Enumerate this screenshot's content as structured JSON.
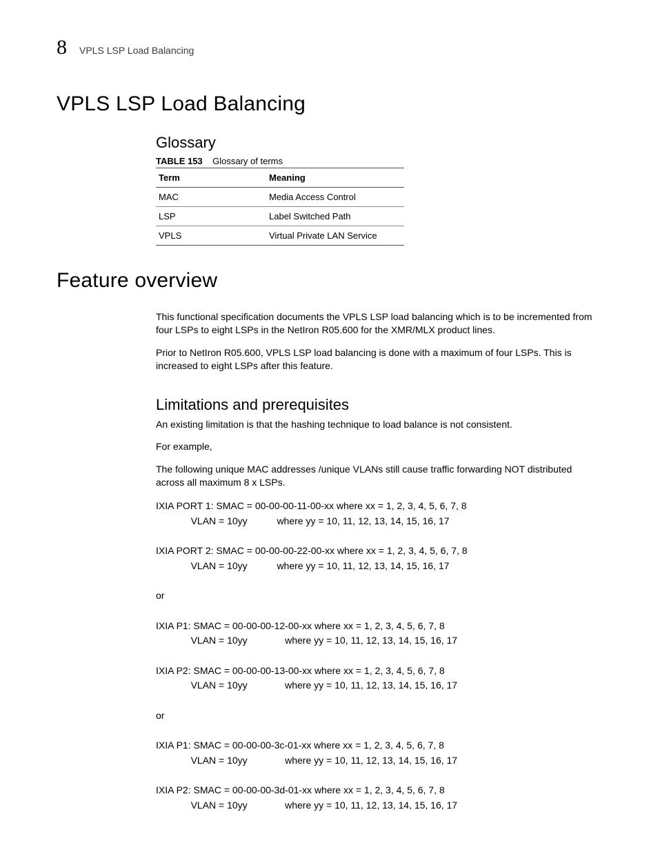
{
  "header": {
    "chapter_number": "8",
    "running_title": "VPLS LSP Load Balancing"
  },
  "section1": {
    "title": "VPLS LSP Load Balancing",
    "glossary": {
      "heading": "Glossary",
      "table_number": "TABLE 153",
      "table_caption": "Glossary of terms",
      "col_term": "Term",
      "col_meaning": "Meaning",
      "rows": [
        {
          "term": "MAC",
          "meaning": "Media Access Control"
        },
        {
          "term": "LSP",
          "meaning": "Label Switched Path"
        },
        {
          "term": "VPLS",
          "meaning": "Virtual Private LAN Service"
        }
      ]
    }
  },
  "section2": {
    "title": "Feature overview",
    "para1": "This functional specification documents the VPLS LSP load balancing which is to be incremented from four LSPs to eight LSPs in the NetIron R05.600 for the XMR/MLX product lines.",
    "para2": "Prior to NetIron R05.600, VPLS LSP load balancing is done with a maximum of four LSPs. This is increased to eight LSPs after this feature.",
    "limitations": {
      "heading": "Limitations and prerequisites",
      "para1": "An existing limitation is that the hashing technique to load balance is not consistent.",
      "para2": "For example,",
      "para3": "The following unique MAC addresses /unique VLANs still cause traffic forwarding NOT distributed across all maximum 8 x LSPs.",
      "example_block": "IXIA PORT 1: SMAC = 00-00-00-11-00-xx where xx = 1, 2, 3, 4, 5, 6, 7, 8\n             VLAN = 10yy           where yy = 10, 11, 12, 13, 14, 15, 16, 17\n\nIXIA PORT 2: SMAC = 00-00-00-22-00-xx where xx = 1, 2, 3, 4, 5, 6, 7, 8\n             VLAN = 10yy           where yy = 10, 11, 12, 13, 14, 15, 16, 17\n\nor\n\nIXIA P1: SMAC = 00-00-00-12-00-xx where xx = 1, 2, 3, 4, 5, 6, 7, 8\n             VLAN = 10yy              where yy = 10, 11, 12, 13, 14, 15, 16, 17\n\nIXIA P2: SMAC = 00-00-00-13-00-xx where xx = 1, 2, 3, 4, 5, 6, 7, 8\n             VLAN = 10yy              where yy = 10, 11, 12, 13, 14, 15, 16, 17\n\nor\n\nIXIA P1: SMAC = 00-00-00-3c-01-xx where xx = 1, 2, 3, 4, 5, 6, 7, 8\n             VLAN = 10yy              where yy = 10, 11, 12, 13, 14, 15, 16, 17\n\nIXIA P2: SMAC = 00-00-00-3d-01-xx where xx = 1, 2, 3, 4, 5, 6, 7, 8\n             VLAN = 10yy              where yy = 10, 11, 12, 13, 14, 15, 16, 17"
    }
  }
}
